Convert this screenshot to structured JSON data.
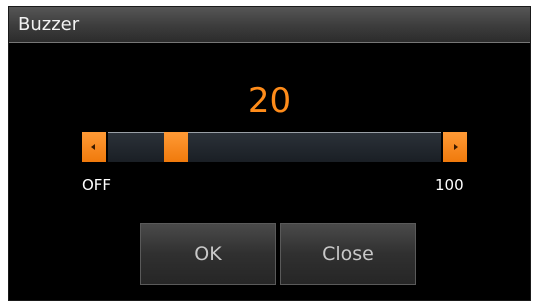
{
  "dialog": {
    "title": "Buzzer"
  },
  "slider": {
    "value_text": "20",
    "value": 20,
    "min": 0,
    "max": 100,
    "min_label": "OFF",
    "max_label": "100",
    "left_arrow_icon": "arrow-left-icon",
    "right_arrow_icon": "arrow-right-icon"
  },
  "buttons": {
    "ok_label": "OK",
    "close_label": "Close"
  },
  "colors": {
    "accent": "#ff8c1a",
    "background": "#000000",
    "track": "#1f252b",
    "title_bar": "#3c3c3c"
  }
}
